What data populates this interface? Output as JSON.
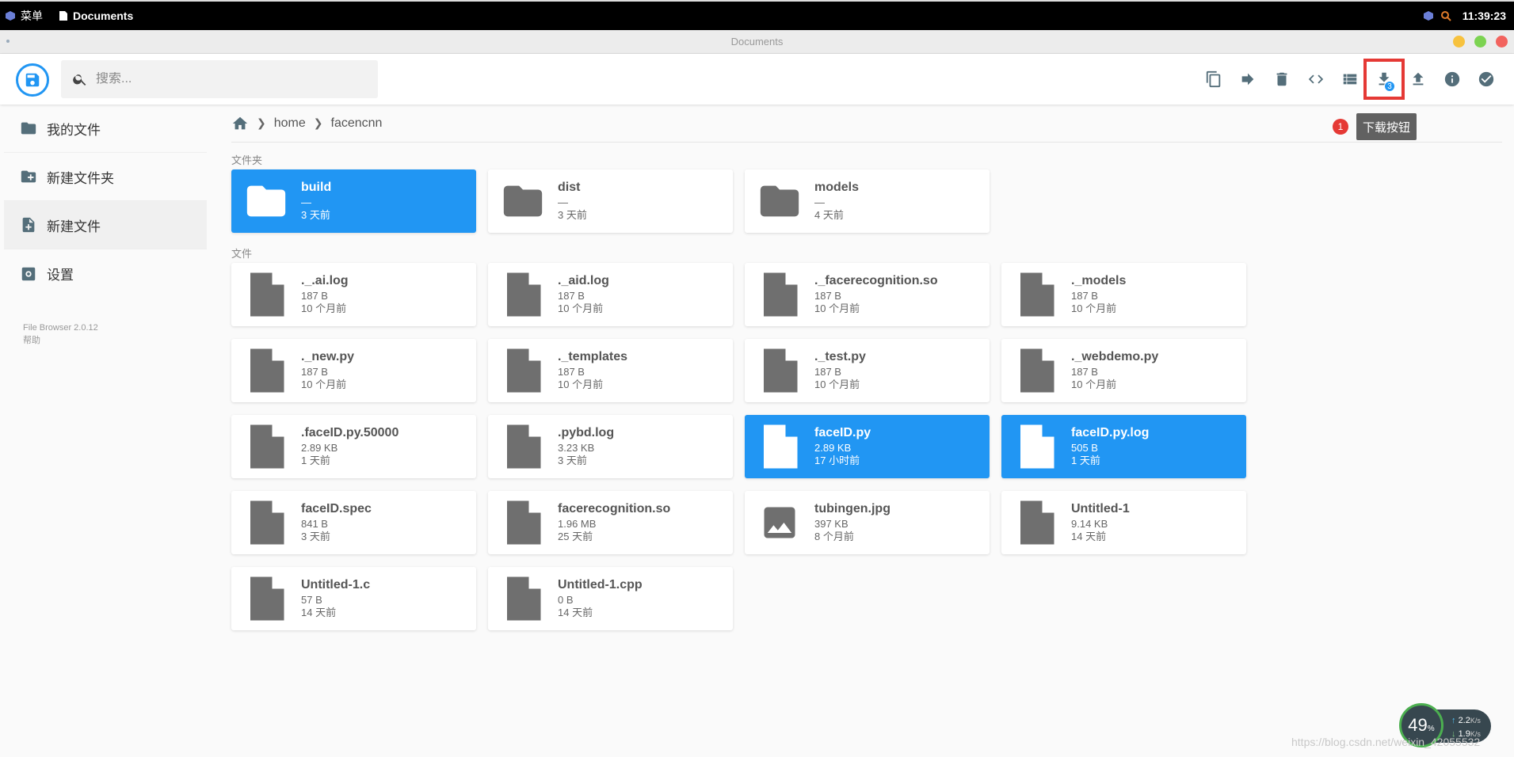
{
  "taskbar": {
    "menu_label": "菜单",
    "window_label": "Documents",
    "clock": "11:39:23"
  },
  "window": {
    "title": "Documents",
    "colors": {
      "minimize": "#f7c23e",
      "maximize": "#7cd351",
      "close": "#f2635e"
    }
  },
  "header": {
    "search_placeholder": "搜索...",
    "download_badge": "3",
    "actions": [
      "copy-icon",
      "move-icon",
      "delete-icon",
      "code-icon",
      "list-view-icon",
      "download-icon",
      "upload-icon",
      "info-icon",
      "check-circle-icon"
    ]
  },
  "annotation": {
    "number": "1",
    "tooltip": "下载按钮"
  },
  "sidebar": {
    "items": [
      {
        "label": "我的文件",
        "icon": "folder-icon"
      },
      {
        "label": "新建文件夹",
        "icon": "create-new-folder-icon"
      },
      {
        "label": "新建文件",
        "icon": "note-add-icon"
      },
      {
        "label": "设置",
        "icon": "settings-icon"
      }
    ],
    "version": "File Browser 2.0.12",
    "help": "帮助"
  },
  "breadcrumb": {
    "items": [
      "home",
      "facencnn"
    ]
  },
  "sections": {
    "folders_label": "文件夹",
    "files_label": "文件"
  },
  "folders": [
    {
      "name": "build",
      "size": "—",
      "date": "3 天前",
      "selected": true
    },
    {
      "name": "dist",
      "size": "—",
      "date": "3 天前",
      "selected": false
    },
    {
      "name": "models",
      "size": "—",
      "date": "4 天前",
      "selected": false
    }
  ],
  "files": [
    {
      "name": "._.ai.log",
      "size": "187 B",
      "date": "10 个月前",
      "selected": false,
      "type": "file"
    },
    {
      "name": "._aid.log",
      "size": "187 B",
      "date": "10 个月前",
      "selected": false,
      "type": "file"
    },
    {
      "name": "._facerecognition.so",
      "size": "187 B",
      "date": "10 个月前",
      "selected": false,
      "type": "file"
    },
    {
      "name": "._models",
      "size": "187 B",
      "date": "10 个月前",
      "selected": false,
      "type": "file"
    },
    {
      "name": "._new.py",
      "size": "187 B",
      "date": "10 个月前",
      "selected": false,
      "type": "file"
    },
    {
      "name": "._templates",
      "size": "187 B",
      "date": "10 个月前",
      "selected": false,
      "type": "file"
    },
    {
      "name": "._test.py",
      "size": "187 B",
      "date": "10 个月前",
      "selected": false,
      "type": "file"
    },
    {
      "name": "._webdemo.py",
      "size": "187 B",
      "date": "10 个月前",
      "selected": false,
      "type": "file"
    },
    {
      "name": ".faceID.py.50000",
      "size": "2.89 KB",
      "date": "1 天前",
      "selected": false,
      "type": "file"
    },
    {
      "name": ".pybd.log",
      "size": "3.23 KB",
      "date": "3 天前",
      "selected": false,
      "type": "file"
    },
    {
      "name": "faceID.py",
      "size": "2.89 KB",
      "date": "17 小时前",
      "selected": true,
      "type": "file"
    },
    {
      "name": "faceID.py.log",
      "size": "505 B",
      "date": "1 天前",
      "selected": true,
      "type": "file"
    },
    {
      "name": "faceID.spec",
      "size": "841 B",
      "date": "3 天前",
      "selected": false,
      "type": "file"
    },
    {
      "name": "facerecognition.so",
      "size": "1.96 MB",
      "date": "25 天前",
      "selected": false,
      "type": "file"
    },
    {
      "name": "tubingen.jpg",
      "size": "397 KB",
      "date": "8 个月前",
      "selected": false,
      "type": "image"
    },
    {
      "name": "Untitled-1",
      "size": "9.14 KB",
      "date": "14 天前",
      "selected": false,
      "type": "file"
    },
    {
      "name": "Untitled-1.c",
      "size": "57 B",
      "date": "14 天前",
      "selected": false,
      "type": "file"
    },
    {
      "name": "Untitled-1.cpp",
      "size": "0 B",
      "date": "14 天前",
      "selected": false,
      "type": "file"
    }
  ],
  "speed_widget": {
    "percent": "49",
    "up": "2.2",
    "up_unit": "K/s",
    "down": "1.9",
    "down_unit": "K/s"
  },
  "watermark": "https://blog.csdn.net/weixin_42055532"
}
